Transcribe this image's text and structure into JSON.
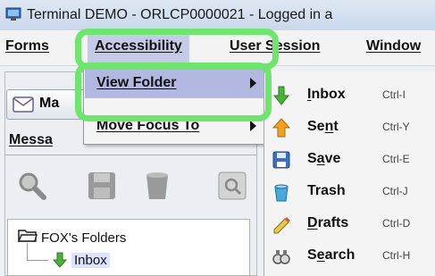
{
  "window": {
    "title": "Terminal DEMO - ORLCP0000021 - Logged in a",
    "icon": "terminal-app-icon"
  },
  "menubar": [
    {
      "key": "forms",
      "label": "Forms"
    },
    {
      "key": "accessibility",
      "label": "Accessibility",
      "active": true
    },
    {
      "key": "user_session",
      "label": "User Session"
    },
    {
      "key": "window",
      "label": "Window"
    }
  ],
  "accessibility_menu": {
    "items": [
      {
        "label": "View Folder",
        "selected": true,
        "has_submenu": true
      },
      {
        "label": "Move Focus To",
        "selected": false,
        "has_submenu": true
      }
    ]
  },
  "folder_submenu": {
    "items": [
      {
        "pre": "",
        "ul": "I",
        "post": "nbox",
        "shortcut": "Ctrl-I",
        "icon": "inbox-arrow-icon"
      },
      {
        "pre": "Se",
        "ul": "n",
        "post": "t",
        "shortcut": "Ctrl-Y",
        "icon": "sent-arrow-icon"
      },
      {
        "pre": "S",
        "ul": "a",
        "post": "ve",
        "shortcut": "Ctrl-E",
        "icon": "save-disk-icon"
      },
      {
        "pre": "",
        "ul": "",
        "post": "Trash",
        "shortcut": "Ctrl-J",
        "icon": "trash-icon"
      },
      {
        "pre": "",
        "ul": "D",
        "post": "rafts",
        "shortcut": "Ctrl-D",
        "icon": "drafts-pencil-icon"
      },
      {
        "pre": "S",
        "ul": "e",
        "post": "arch",
        "shortcut": "Ctrl-H",
        "icon": "search-binoculars-icon"
      }
    ]
  },
  "left_panel": {
    "mail_header": "Ma",
    "tab_label": "Messa",
    "toolbar_icons": [
      "search-icon",
      "save-icon",
      "trash-icon",
      "find-icon"
    ],
    "tree": {
      "root": "FOX's Folders",
      "root_icon": "folder-icon",
      "items": [
        {
          "label": "Inbox",
          "icon": "inbox-arrow-icon",
          "selected": true
        }
      ]
    }
  },
  "colors": {
    "highlight": "#6ee66e",
    "menu_selected": "#b2b8e0",
    "menu_active": "#c5cbe6"
  }
}
